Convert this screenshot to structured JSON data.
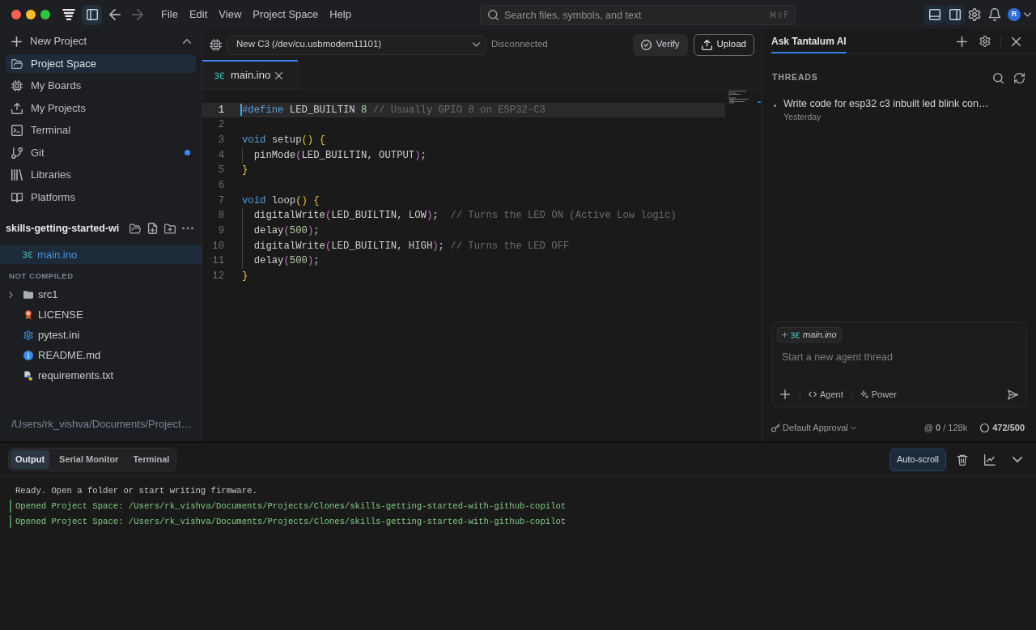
{
  "title_bar": {
    "sidebar_toggle": {
      "on": true
    },
    "navigation": [
      {
        "kind": "back",
        "disabled": false
      },
      {
        "kind": "forward",
        "disabled": true
      }
    ],
    "menu": [
      "File",
      "Edit",
      "View",
      "Project Space",
      "Help"
    ],
    "search": {
      "placeholder": "Search files, symbols, and text",
      "shortcut": "⌘⇧F"
    },
    "layout_toggles": [
      {
        "kind": "bottom_panel",
        "on": true
      },
      {
        "kind": "right_panel",
        "on": true
      }
    ],
    "avatar": "R"
  },
  "sidebar": {
    "new_project": {
      "label": "New Project",
      "expanded": true
    },
    "nav_items": [
      {
        "label": "Project Space",
        "kind": "folder",
        "selected": true,
        "dot": false
      },
      {
        "label": "My Boards",
        "kind": "board",
        "selected": false,
        "dot": false
      },
      {
        "label": "My Projects",
        "kind": "upload",
        "selected": false,
        "dot": false
      },
      {
        "label": "Terminal",
        "kind": "terminal",
        "selected": false,
        "dot": false
      },
      {
        "label": "Git",
        "kind": "git",
        "selected": false,
        "dot": true
      },
      {
        "label": "Libraries",
        "kind": "library",
        "selected": false,
        "dot": false
      },
      {
        "label": "Platforms",
        "kind": "book",
        "selected": false,
        "dot": false
      }
    ],
    "project": {
      "name": "skills-getting-started-wi",
      "open_files": [
        {
          "name": "main.ino",
          "selected": true
        }
      ],
      "section": "NOT COMPILED",
      "tree": [
        {
          "name": "src1",
          "kind": "folder",
          "expanded": false
        },
        {
          "name": "LICENSE",
          "kind": "license"
        },
        {
          "name": "pytest.ini",
          "kind": "config"
        },
        {
          "name": "README.md",
          "kind": "info"
        },
        {
          "name": "requirements.txt",
          "kind": "python"
        }
      ],
      "path": "/Users/rk_vishva/Documents/Project…"
    }
  },
  "editor": {
    "board": "New C3 (/dev/cu.usbmodem11101)",
    "connection": "Disconnected",
    "actions": [
      {
        "kind": "verify",
        "label": "Verify"
      },
      {
        "kind": "upload",
        "label": "Upload"
      }
    ],
    "tabs": [
      {
        "label": "main.ino",
        "selected": true
      }
    ],
    "lines": [
      {
        "number": "1",
        "active": true,
        "indented": false,
        "tokens": [
          {
            "kind": "keyword",
            "text": "#define"
          },
          {
            "kind": "plain",
            "text": " LED_BUILTIN "
          },
          {
            "kind": "number",
            "text": "8"
          },
          {
            "kind": "comment",
            "text": " // Usually GPIO 8 on ESP32-C3"
          }
        ]
      },
      {
        "number": "2",
        "active": false,
        "indented": false
      },
      {
        "number": "3",
        "active": false,
        "indented": false,
        "tokens": [
          {
            "kind": "keyword",
            "text": "void"
          },
          {
            "kind": "plain",
            "text": " setup"
          },
          {
            "kind": "bracket1",
            "text": "() {"
          }
        ]
      },
      {
        "number": "4",
        "active": false,
        "indented": true,
        "tokens": [
          {
            "kind": "plain",
            "text": "pinMode"
          },
          {
            "kind": "bracket2",
            "text": "("
          },
          {
            "kind": "plain",
            "text": "LED_BUILTIN, OUTPUT"
          },
          {
            "kind": "bracket2",
            "text": ")"
          },
          {
            "kind": "plain",
            "text": ";"
          }
        ]
      },
      {
        "number": "5",
        "active": false,
        "indented": false,
        "tokens": [
          {
            "kind": "bracket1",
            "text": "}"
          }
        ]
      },
      {
        "number": "6",
        "active": false,
        "indented": false
      },
      {
        "number": "7",
        "active": false,
        "indented": false,
        "tokens": [
          {
            "kind": "keyword",
            "text": "void"
          },
          {
            "kind": "plain",
            "text": " loop"
          },
          {
            "kind": "bracket1",
            "text": "() {"
          }
        ]
      },
      {
        "number": "8",
        "active": false,
        "indented": true,
        "tokens": [
          {
            "kind": "plain",
            "text": "digitalWrite"
          },
          {
            "kind": "bracket2",
            "text": "("
          },
          {
            "kind": "plain",
            "text": "LED_BUILTIN, LOW"
          },
          {
            "kind": "bracket2",
            "text": ")"
          },
          {
            "kind": "plain",
            "text": ";  "
          },
          {
            "kind": "comment",
            "text": "// Turns the LED ON (Active Low logic)"
          }
        ]
      },
      {
        "number": "9",
        "active": false,
        "indented": true,
        "tokens": [
          {
            "kind": "plain",
            "text": "delay"
          },
          {
            "kind": "bracket2",
            "text": "("
          },
          {
            "kind": "number",
            "text": "500"
          },
          {
            "kind": "bracket2",
            "text": ")"
          },
          {
            "kind": "plain",
            "text": ";"
          }
        ]
      },
      {
        "number": "10",
        "active": false,
        "indented": true,
        "tokens": [
          {
            "kind": "plain",
            "text": "digitalWrite"
          },
          {
            "kind": "bracket2",
            "text": "("
          },
          {
            "kind": "plain",
            "text": "LED_BUILTIN, HIGH"
          },
          {
            "kind": "bracket2",
            "text": ")"
          },
          {
            "kind": "plain",
            "text": "; "
          },
          {
            "kind": "comment",
            "text": "// Turns the LED OFF"
          }
        ]
      },
      {
        "number": "11",
        "active": false,
        "indented": true,
        "tokens": [
          {
            "kind": "plain",
            "text": "delay"
          },
          {
            "kind": "bracket2",
            "text": "("
          },
          {
            "kind": "number",
            "text": "500"
          },
          {
            "kind": "bracket2",
            "text": ")"
          },
          {
            "kind": "plain",
            "text": ";"
          }
        ]
      },
      {
        "number": "12",
        "active": false,
        "indented": false,
        "tokens": [
          {
            "kind": "bracket1",
            "text": "}"
          }
        ]
      }
    ]
  },
  "ai_panel": {
    "tabs": [
      {
        "label": "Ask Tantalum AI",
        "selected": true
      }
    ],
    "threads_label": "THREADS",
    "threads": [
      {
        "title": "Write code for esp32 c3 inbuilt led blink con…",
        "time": "Yesterday"
      }
    ],
    "composer": {
      "context_file": "main.ino",
      "placeholder": "Start a new agent thread",
      "modes": [
        {
          "kind": "agent",
          "label": "Agent"
        },
        {
          "kind": "power",
          "label": "Power"
        }
      ]
    },
    "footer": {
      "approval": "Default Approval",
      "context_usage": "@ **0** / 128k",
      "quota": "472/500"
    }
  },
  "bottom_panel": {
    "tabs": [
      {
        "label": "Output",
        "selected": true
      },
      {
        "label": "Serial Monitor",
        "selected": false
      },
      {
        "label": "Terminal",
        "selected": false
      }
    ],
    "auto_scroll": {
      "label": "Auto-scroll",
      "on": true
    },
    "log": [
      {
        "kind": "info",
        "text": "Ready. Open a folder or start writing firmware."
      },
      {
        "kind": "success",
        "text": "Opened Project Space: /Users/rk_vishva/Documents/Projects/Clones/skills-getting-started-with-github-copilot"
      },
      {
        "kind": "success",
        "text": "Opened Project Space: /Users/rk_vishva/Documents/Projects/Clones/skills-getting-started-with-github-copilot"
      }
    ]
  }
}
